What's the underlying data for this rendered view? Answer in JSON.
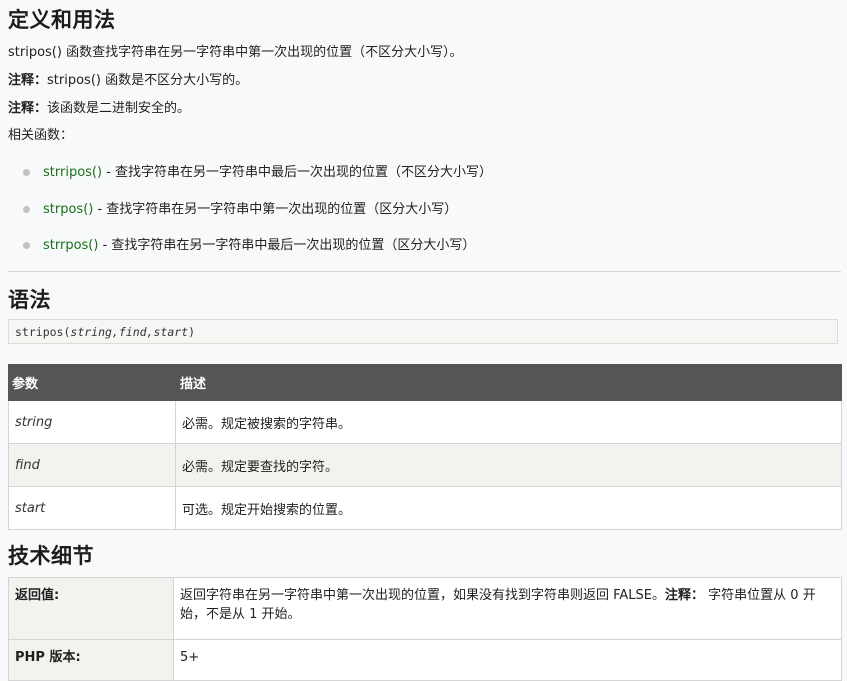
{
  "definition": {
    "heading": "定义和用法",
    "intro": "stripos() 函数查找字符串在另一字符串中第一次出现的位置（不区分大小写）。",
    "notes": [
      {
        "label": "注释：",
        "text": "stripos() 函数是不区分大小写的。"
      },
      {
        "label": "注释：",
        "text": "该函数是二进制安全的。"
      }
    ],
    "related_label": "相关函数：",
    "related": [
      {
        "name": "strripos()",
        "desc": " - 查找字符串在另一字符串中最后一次出现的位置（不区分大小写）"
      },
      {
        "name": "strpos()",
        "desc": " - 查找字符串在另一字符串中第一次出现的位置（区分大小写）"
      },
      {
        "name": "strrpos()",
        "desc": " - 查找字符串在另一字符串中最后一次出现的位置（区分大小写）"
      }
    ]
  },
  "syntax": {
    "heading": "语法",
    "code_prefix": "stripos(",
    "code_params": "string,find,start",
    "code_suffix": ")"
  },
  "params_table": {
    "headers": [
      "参数",
      "描述"
    ],
    "rows": [
      {
        "name": "string",
        "desc": "必需。规定被搜索的字符串。"
      },
      {
        "name": "find",
        "desc": "必需。规定要查找的字符。"
      },
      {
        "name": "start",
        "desc": "可选。规定开始搜索的位置。"
      }
    ]
  },
  "tech": {
    "heading": "技术细节",
    "rows": [
      {
        "key": "返回值:",
        "value": "返回字符串在另一字符串中第一次出现的位置，如果没有找到字符串则返回 FALSE。",
        "note_label": "注释：",
        "note": " 字符串位置从 0 开始，不是从 1 开始。"
      },
      {
        "key": "PHP 版本:",
        "value": "5+",
        "note_label": "",
        "note": ""
      }
    ]
  },
  "colors": {
    "function_link": "#197019",
    "table_header_bg": "#555555",
    "alt_row_bg": "#f3f2ee",
    "page_bg": "#f8f9fb"
  }
}
